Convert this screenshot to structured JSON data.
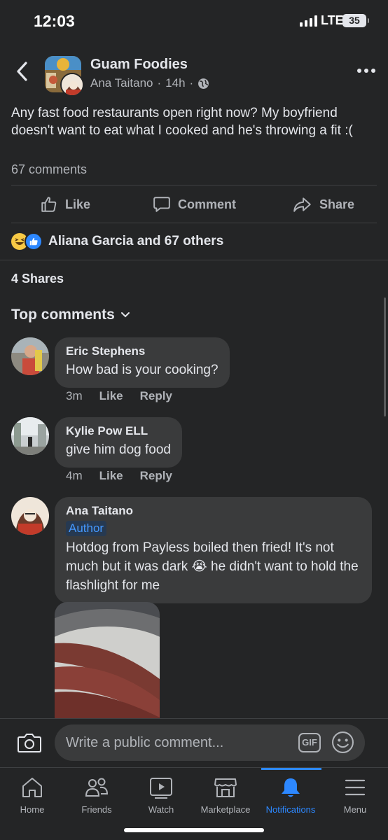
{
  "status_bar": {
    "time": "12:03",
    "network": "LTE",
    "battery": "35"
  },
  "post": {
    "group_name": "Guam Foodies",
    "author": "Ana Taitano",
    "time_ago": "14h",
    "separator": "·",
    "text": "Any fast food restaurants open right now? My boyfriend doesn't want to eat what I cooked and he's throwing a fit :(",
    "comment_count": "67 comments",
    "reactions_text": "Aliana Garcia and 67 others",
    "shares": "4 Shares"
  },
  "actions": {
    "like": "Like",
    "comment": "Comment",
    "share": "Share"
  },
  "top_comments_label": "Top comments",
  "comments": [
    {
      "name": "Eric Stephens",
      "text": "How bad is your cooking?",
      "time": "3m",
      "like": "Like",
      "reply": "Reply"
    },
    {
      "name": "Kylie Pow ELL",
      "text": "give him dog food",
      "time": "4m",
      "like": "Like",
      "reply": "Reply"
    },
    {
      "name": "Ana Taitano",
      "badge": "Author",
      "text": "Hotdog from Payless boiled then fried! It's not much but it was dark 😭 he didn't want to hold the flashlight for me"
    }
  ],
  "comment_input": {
    "placeholder": "Write a public comment...",
    "gif": "GIF"
  },
  "tabs": [
    {
      "label": "Home",
      "icon": "home-icon"
    },
    {
      "label": "Friends",
      "icon": "friends-icon"
    },
    {
      "label": "Watch",
      "icon": "watch-icon"
    },
    {
      "label": "Marketplace",
      "icon": "marketplace-icon"
    },
    {
      "label": "Notifications",
      "icon": "bell-icon",
      "active": true
    },
    {
      "label": "Menu",
      "icon": "menu-icon"
    }
  ],
  "colors": {
    "background": "#242526",
    "bubble": "#3a3b3c",
    "accent": "#2d88ff",
    "secondary_text": "#b0b3b8"
  }
}
